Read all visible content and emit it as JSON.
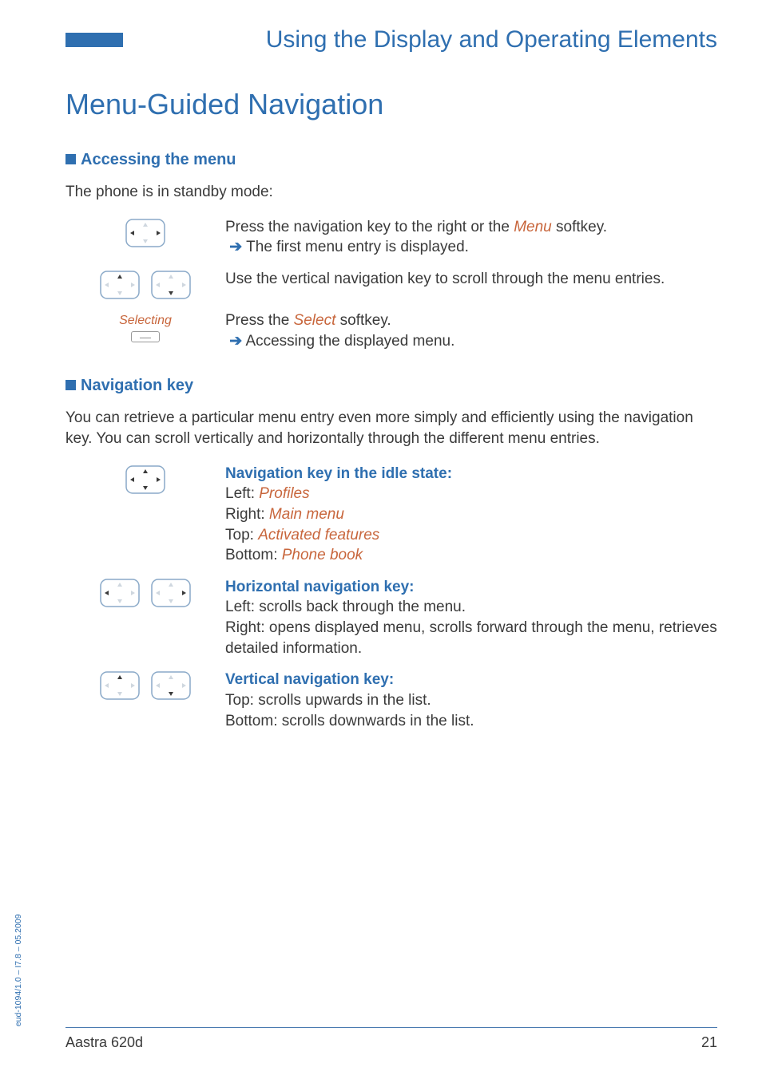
{
  "header": {
    "title": "Using the Display and Operating Elements"
  },
  "main_heading": "Menu-Guided Navigation",
  "section1": {
    "heading": "Accessing the menu",
    "intro": "The phone is in standby mode:",
    "row1": {
      "text_a": "Press the navigation key to the right or the ",
      "menu": "Menu",
      "text_b": " softkey.",
      "result": "The first menu entry is displayed."
    },
    "row2": {
      "text": "Use the vertical navigation key to scroll through the menu entries."
    },
    "row3": {
      "label": "Selecting",
      "text_a": "Press the ",
      "select": "Select",
      "text_b": " softkey.",
      "result": "Accessing the displayed menu."
    }
  },
  "section2": {
    "heading": "Navigation key",
    "intro": "You can retrieve a particular menu entry even more simply and efficiently using the navigation key. You can scroll vertically and horizontally through the different menu entries.",
    "idle": {
      "title": "Navigation key in the idle state:",
      "left_label": "Left: ",
      "left_val": "Profiles",
      "right_label": "Right: ",
      "right_val": "Main menu",
      "top_label": "Top: ",
      "top_val": "Activated features",
      "bottom_label": "Bottom: ",
      "bottom_val": "Phone book"
    },
    "horiz": {
      "title": "Horizontal navigation key:",
      "left": "Left: scrolls back through the menu.",
      "right": "Right: opens displayed menu, scrolls forward through the menu, retrieves detailed information."
    },
    "vert": {
      "title": "Vertical navigation key:",
      "top": "Top: scrolls upwards in the list.",
      "bottom": "Bottom: scrolls downwards in the list."
    }
  },
  "footer": {
    "model": "Aastra 620d",
    "page": "21"
  },
  "doc_id": "eud-1094/1.0 – I7.8 – 05.2009"
}
